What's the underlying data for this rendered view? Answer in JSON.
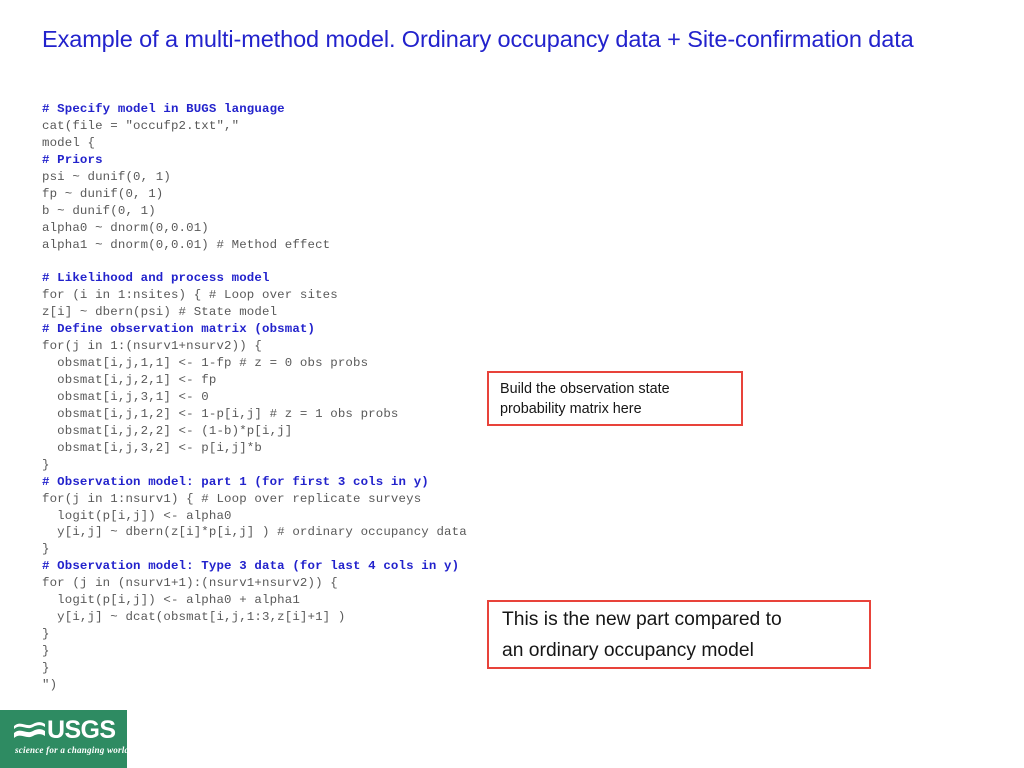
{
  "slide": {
    "title": "Example of a multi-method model. Ordinary occupancy data + Site-confirmation data",
    "background_color": "#ffffff",
    "title_color": "#2222CC"
  },
  "code": {
    "language": "BUGS / R",
    "text_color": "#595959",
    "comment_color": "#2222CC",
    "lines": [
      {
        "text": "# Specify model in BUGS language",
        "type": "comment"
      },
      {
        "text": "cat(file = \"occufp2.txt\",\"",
        "type": "code"
      },
      {
        "text": "model {",
        "type": "code"
      },
      {
        "text": "# Priors",
        "type": "comment"
      },
      {
        "text": "psi ~ dunif(0, 1)",
        "type": "code"
      },
      {
        "text": "fp ~ dunif(0, 1)",
        "type": "code"
      },
      {
        "text": "b ~ dunif(0, 1)",
        "type": "code"
      },
      {
        "text": "alpha0 ~ dnorm(0,0.01)",
        "type": "code"
      },
      {
        "text": "alpha1 ~ dnorm(0,0.01) # Method effect",
        "type": "code"
      },
      {
        "text": "",
        "type": "blank"
      },
      {
        "text": "# Likelihood and process model",
        "type": "comment"
      },
      {
        "text": "for (i in 1:nsites) { # Loop over sites",
        "type": "code"
      },
      {
        "text": "z[i] ~ dbern(psi) # State model",
        "type": "code"
      },
      {
        "text": "# Define observation matrix (obsmat)",
        "type": "comment"
      },
      {
        "text": "for(j in 1:(nsurv1+nsurv2)) {",
        "type": "code"
      },
      {
        "text": "  obsmat[i,j,1,1] <- 1-fp # z = 0 obs probs",
        "type": "code"
      },
      {
        "text": "  obsmat[i,j,2,1] <- fp",
        "type": "code"
      },
      {
        "text": "  obsmat[i,j,3,1] <- 0",
        "type": "code"
      },
      {
        "text": "  obsmat[i,j,1,2] <- 1-p[i,j] # z = 1 obs probs",
        "type": "code"
      },
      {
        "text": "  obsmat[i,j,2,2] <- (1-b)*p[i,j]",
        "type": "code"
      },
      {
        "text": "  obsmat[i,j,3,2] <- p[i,j]*b",
        "type": "code"
      },
      {
        "text": "}",
        "type": "code"
      },
      {
        "text": "# Observation model: part 1 (for first 3 cols in y)",
        "type": "comment"
      },
      {
        "text": "for(j in 1:nsurv1) { # Loop over replicate surveys",
        "type": "code"
      },
      {
        "text": "  logit(p[i,j]) <- alpha0",
        "type": "code"
      },
      {
        "text": "  y[i,j] ~ dbern(z[i]*p[i,j] ) # ordinary occupancy data",
        "type": "code"
      },
      {
        "text": "}",
        "type": "code"
      },
      {
        "text": "# Observation model: Type 3 data (for last 4 cols in y)",
        "type": "comment"
      },
      {
        "text": "for (j in (nsurv1+1):(nsurv1+nsurv2)) {",
        "type": "code"
      },
      {
        "text": "  logit(p[i,j]) <- alpha0 + alpha1",
        "type": "code"
      },
      {
        "text": "  y[i,j] ~ dcat(obsmat[i,j,1:3,z[i]+1] )",
        "type": "code"
      },
      {
        "text": "}",
        "type": "code"
      },
      {
        "text": "}",
        "type": "code"
      },
      {
        "text": "}",
        "type": "code"
      },
      {
        "text": "\")",
        "type": "code"
      }
    ]
  },
  "callouts": {
    "border_color": "#E8433A",
    "observation_matrix": {
      "line1": "Build the observation state",
      "line2": "probability matrix here"
    },
    "new_part": {
      "line1": "This is the new part compared to",
      "line2": "an ordinary occupancy model"
    }
  },
  "logo": {
    "wordmark": "USGS",
    "tagline": "science for a changing world",
    "background_color": "#2E8B62",
    "foreground_color": "#ffffff"
  }
}
